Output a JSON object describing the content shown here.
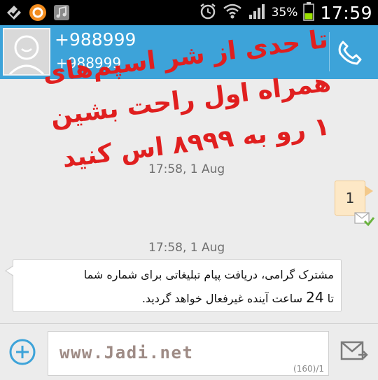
{
  "status_bar": {
    "battery_percent": "35%",
    "time": "17:59",
    "icons": [
      "gesture-icon",
      "avast-icon",
      "music-icon",
      "alarm-icon",
      "wifi-icon",
      "signal-icon",
      "battery-icon"
    ]
  },
  "contact": {
    "name": "+988999",
    "number": "+988999"
  },
  "messages": [
    {
      "direction": "sent",
      "timestamp": "17:58, 1 Aug",
      "text": "1"
    },
    {
      "direction": "received",
      "timestamp": "17:58, 1 Aug",
      "line1": "مشترک گرامی، دریافت پیام تبلیغاتی برای شماره شما",
      "line2_before": "تا ",
      "line2_num": "24",
      "line2_after": " ساعت آینده غیرفعال خواهد گردید."
    }
  ],
  "overlay": {
    "line1": "تا حدی از شر اسپم‌های",
    "line2": "همراه اول راحت بشین",
    "line3": "۱ رو به ۸۹۹۹ اس کنید",
    "color": "#e01f1f"
  },
  "compose": {
    "watermark": "www.Jadi.net",
    "counter": "(160)/1"
  },
  "colors": {
    "header": "#3da3d9",
    "sent_bubble": "#fde8c6"
  }
}
